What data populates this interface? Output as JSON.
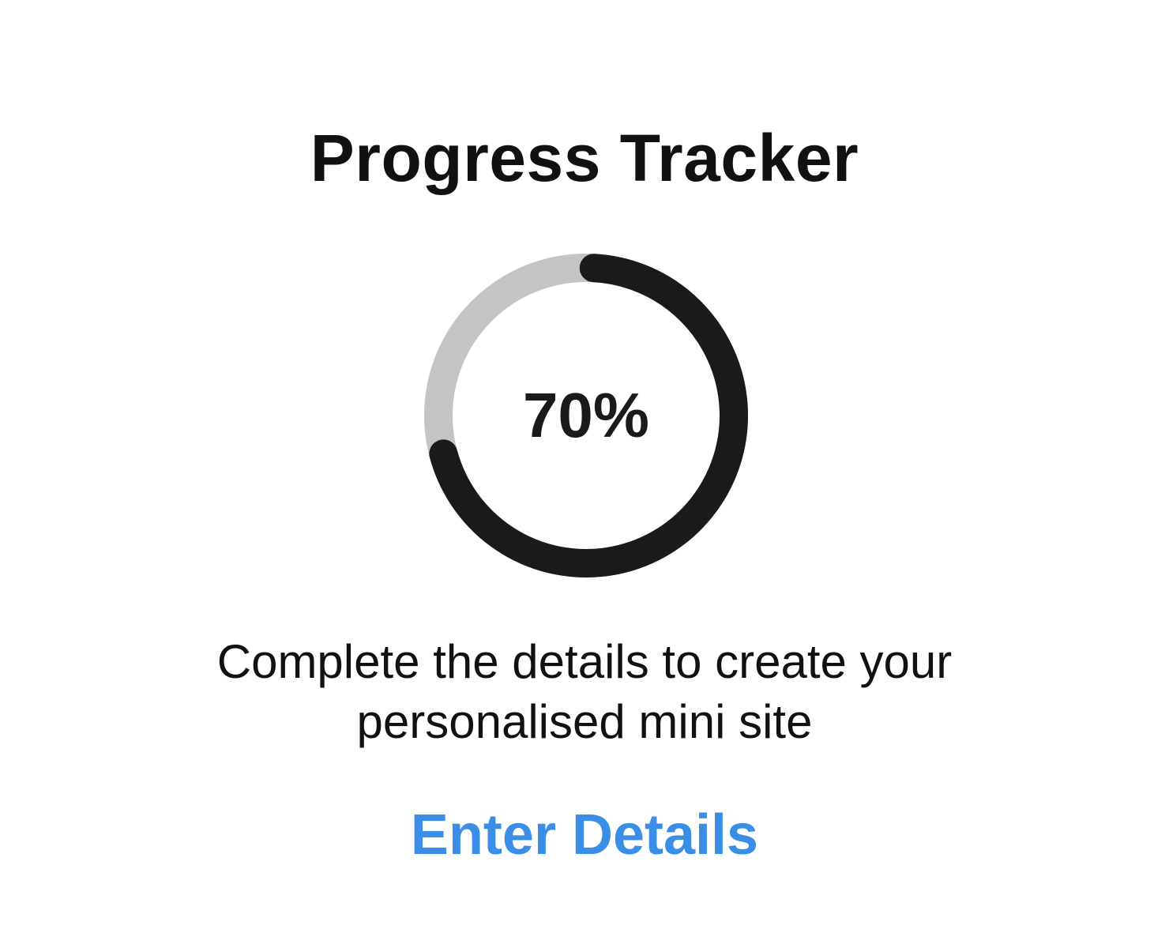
{
  "header": {
    "title": "Progress Tracker"
  },
  "progress": {
    "value": 70,
    "label": "70%",
    "track_color": "#c4c4c4",
    "fill_color": "#1a1a1c"
  },
  "description": {
    "text": "Complete the details to create your personalised mini site"
  },
  "cta": {
    "label": "Enter Details",
    "color": "#3a8ee6"
  }
}
